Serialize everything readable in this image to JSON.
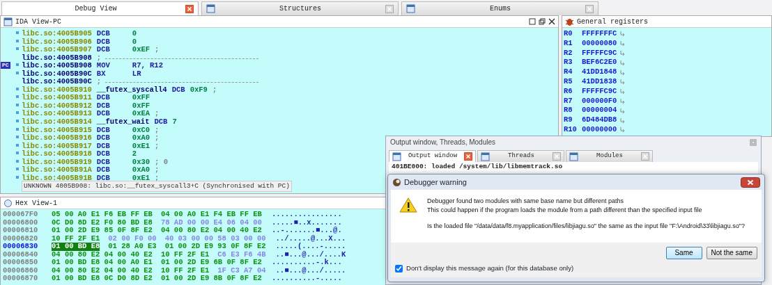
{
  "tabs": [
    {
      "label": "Debug View",
      "selected": true
    },
    {
      "label": "Structures",
      "selected": false
    },
    {
      "label": "Enums",
      "selected": false
    }
  ],
  "disassembly": {
    "title": "IDA View-PC",
    "lines": [
      {
        "kind": "data",
        "addr": "libc.so:4005B905",
        "op": "DCB",
        "arg": "0"
      },
      {
        "kind": "data",
        "addr": "libc.so:4005B906",
        "op": "DCB",
        "arg": "0"
      },
      {
        "kind": "data",
        "addr": "libc.so:4005B907",
        "op": "DCB",
        "arg": "0xEF",
        "comment": ";"
      },
      {
        "kind": "separator",
        "addr": "libc.so:4005B908",
        "comment": ";"
      },
      {
        "kind": "code",
        "addr": "libc.so:4005B908",
        "op": "MOV",
        "arg": "R7, R12",
        "pc": "PC"
      },
      {
        "kind": "code",
        "addr": "libc.so:4005B90C",
        "op": "BX",
        "arg": "LR"
      },
      {
        "kind": "separator",
        "addr": "libc.so:4005B90C",
        "comment": ";"
      },
      {
        "kind": "data",
        "addr": "libc.so:4005B910",
        "label": "__futex_syscall4",
        "op": "DCB",
        "arg": "0xF9",
        "comment": ";"
      },
      {
        "kind": "data",
        "addr": "libc.so:4005B911",
        "op": "DCB",
        "arg": "0xFF"
      },
      {
        "kind": "data",
        "addr": "libc.so:4005B912",
        "op": "DCB",
        "arg": "0xFF"
      },
      {
        "kind": "data",
        "addr": "libc.so:4005B913",
        "op": "DCB",
        "arg": "0xEA",
        "comment": ";"
      },
      {
        "kind": "data",
        "addr": "libc.so:4005B914",
        "label": "__futex_wait",
        "op": "DCB",
        "arg": "7"
      },
      {
        "kind": "data",
        "addr": "libc.so:4005B915",
        "op": "DCB",
        "arg": "0xC0",
        "comment": ";"
      },
      {
        "kind": "data",
        "addr": "libc.so:4005B916",
        "op": "DCB",
        "arg": "0xA0",
        "comment": ";"
      },
      {
        "kind": "data",
        "addr": "libc.so:4005B917",
        "op": "DCB",
        "arg": "0xE1",
        "comment": ";"
      },
      {
        "kind": "data",
        "addr": "libc.so:4005B918",
        "op": "DCB",
        "arg": "2"
      },
      {
        "kind": "data",
        "addr": "libc.so:4005B919",
        "op": "DCB",
        "arg": "0x30",
        "comment": "; 0"
      },
      {
        "kind": "data",
        "addr": "libc.so:4005B91A",
        "op": "DCB",
        "arg": "0xA0",
        "comment": ";"
      },
      {
        "kind": "data",
        "addr": "libc.so:4005B91B",
        "op": "DCB",
        "arg": "0xE1",
        "comment": ";"
      }
    ],
    "status": "UNKNOWN 4005B908: libc.so:__futex_syscall3+C (Synchronised with PC)"
  },
  "registers": {
    "title": "General registers",
    "items": [
      {
        "name": "R0",
        "value": "FFFFFFFC"
      },
      {
        "name": "R1",
        "value": "00000080"
      },
      {
        "name": "R2",
        "value": "FFFFFC9C"
      },
      {
        "name": "R3",
        "value": "BEF6C2E0"
      },
      {
        "name": "R4",
        "value": "41DD1848"
      },
      {
        "name": "R5",
        "value": "41DD1838"
      },
      {
        "name": "R6",
        "value": "FFFFFC9C"
      },
      {
        "name": "R7",
        "value": "000000F0"
      },
      {
        "name": "R8",
        "value": "00000004"
      },
      {
        "name": "R9",
        "value": "6D484DB8"
      },
      {
        "name": "R10",
        "value": "00000000"
      }
    ]
  },
  "hex_view": {
    "title": "Hex View-1",
    "rows": [
      {
        "addr": "000067F0",
        "selected": false,
        "segments": [
          {
            "kind": "normal",
            "text": "05 00 A0 E1 F6 EB FF EB"
          },
          {
            "kind": "normal",
            "text": "04 00 A0 E1 F4 EB FF EB"
          }
        ],
        "ascii": "................"
      },
      {
        "addr": "00006800",
        "selected": false,
        "segments": [
          {
            "kind": "normal",
            "text": "0C D0 8D E2 F0 80 BD E8"
          },
          {
            "kind": "dim",
            "text": "78 AD 00 00 E4 06 04 00"
          }
        ],
        "ascii": ".....■..x......."
      },
      {
        "addr": "00006810",
        "selected": false,
        "segments": [
          {
            "kind": "normal",
            "text": "01 00 2D E9 85 0F 8F E2"
          },
          {
            "kind": "normal",
            "text": "04 00 80 E2 04 00 40 E2"
          }
        ],
        "ascii": "..-.......■...@."
      },
      {
        "addr": "00006820",
        "selected": false,
        "segments": [
          {
            "kind": "normal",
            "text": "10 FF 2F E1"
          },
          {
            "kind": "dim",
            "text": "02 00 F0 00"
          },
          {
            "kind": "dim",
            "text": "40 03 00 00 58 03 00 00"
          }
        ],
        "ascii": "../.....@...X..."
      },
      {
        "addr": "00006830",
        "selected": true,
        "segments": [
          {
            "kind": "selected",
            "text": "01 00 BD E8"
          },
          {
            "kind": "normal",
            "text": "01 28 A0 E3"
          },
          {
            "kind": "normal",
            "text": "01 00 2D E9 93 0F 8F E2"
          }
        ],
        "ascii": ".....(....-....."
      },
      {
        "addr": "00006840",
        "selected": false,
        "segments": [
          {
            "kind": "normal",
            "text": "04 00 80 E2 04 00 40 E2"
          },
          {
            "kind": "normal",
            "text": "10 FF 2F E1"
          },
          {
            "kind": "dim",
            "text": "C6 E3 F6 4B"
          }
        ],
        "ascii": "..■...@.../....K"
      },
      {
        "addr": "00006850",
        "selected": false,
        "segments": [
          {
            "kind": "normal",
            "text": "01 00 BD E8 04 00 A0 E1"
          },
          {
            "kind": "normal",
            "text": "01 00 2D E9 6B 0F 8F E2"
          }
        ],
        "ascii": "..........-.k..."
      },
      {
        "addr": "00006860",
        "selected": false,
        "segments": [
          {
            "kind": "normal",
            "text": "04 00 80 E2 04 00 40 E2"
          },
          {
            "kind": "normal",
            "text": "10 FF 2F E1"
          },
          {
            "kind": "dim",
            "text": "1F C3 A7 04"
          }
        ],
        "ascii": "..■...@.../....."
      },
      {
        "addr": "00006870",
        "selected": false,
        "segments": [
          {
            "kind": "normal",
            "text": "01 00 BD E8 0C D0 8D E2"
          },
          {
            "kind": "normal",
            "text": "01 00 2D E9 8B 0F 8F E2"
          }
        ],
        "ascii": "..........-....."
      }
    ]
  },
  "output_panel": {
    "title": "Output window, Threads, Modules",
    "tabs": [
      {
        "label": "Output window",
        "selected": true
      },
      {
        "label": "Threads",
        "selected": false
      },
      {
        "label": "Modules",
        "selected": false
      }
    ],
    "lines": [
      "401BE000: loaded /system/lib/libmemtrack.so"
    ]
  },
  "dialog": {
    "title": "Debugger warning",
    "messages": [
      "Debugger found two modules with same base name but different paths",
      "This could happen if the program loads the module from a path different than the specified input file",
      "Is the loaded file \"/data/data/f8.myapplication/files/libjiagu.so\" the same as the input file \"F:\\Android\\33\\libjiagu.so\"?"
    ],
    "buttons": [
      {
        "label": "Same",
        "default": true
      },
      {
        "label": "Not the same",
        "default": false
      }
    ],
    "checkbox": {
      "label": "Don't display this message again (for this database only)",
      "checked": true
    }
  }
}
